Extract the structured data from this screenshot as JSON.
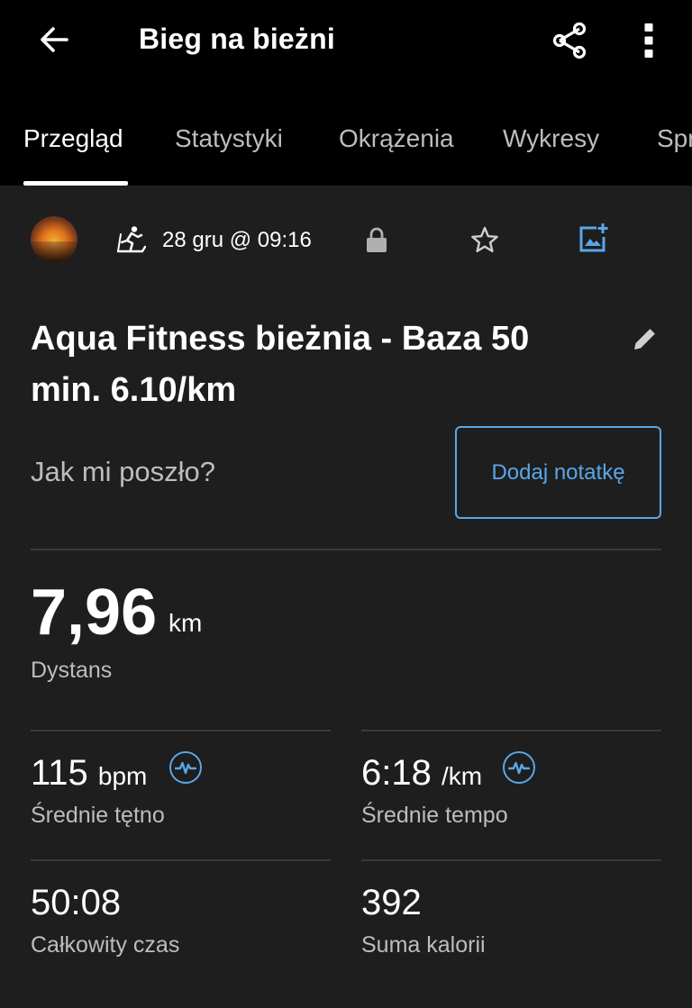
{
  "header": {
    "title": "Bieg na bieżni",
    "icons": {
      "back": "arrow-left-icon",
      "share": "share-icon",
      "more": "more-vert-icon"
    }
  },
  "tabs": [
    {
      "label": "Przegląd",
      "active": true
    },
    {
      "label": "Statystyki",
      "active": false
    },
    {
      "label": "Okrążenia",
      "active": false
    },
    {
      "label": "Wykresy",
      "active": false
    },
    {
      "label": "Spr",
      "active": false
    }
  ],
  "activity_info": {
    "date": "28 gru @ 09:16",
    "icons": {
      "activity_type": "treadmill-run-icon",
      "privacy": "lock-icon",
      "favorite": "star-outline-icon",
      "add_photo": "add-photo-icon"
    }
  },
  "activity": {
    "title": "Aqua Fitness bieżnia - Baza 50 min. 6.10/km",
    "feel_prompt": "Jak mi poszło?",
    "add_note_label": "Dodaj notatkę"
  },
  "summary": {
    "distance": {
      "value": "7,96",
      "unit": "km",
      "label": "Dystans"
    },
    "avg_hr": {
      "value": "115",
      "unit": "bpm",
      "label": "Średnie tętno"
    },
    "avg_pace": {
      "value": "6:18",
      "unit": "/km",
      "label": "Średnie tempo"
    },
    "total_time": {
      "value": "50:08",
      "label": "Całkowity czas"
    },
    "calories": {
      "value": "392",
      "label": "Suma kalorii"
    }
  },
  "colors": {
    "background": "#1e1e1e",
    "header": "#000000",
    "accent": "#5aa6ea",
    "secondary_text": "#bdbdbd",
    "divider": "#3a3a3a"
  }
}
